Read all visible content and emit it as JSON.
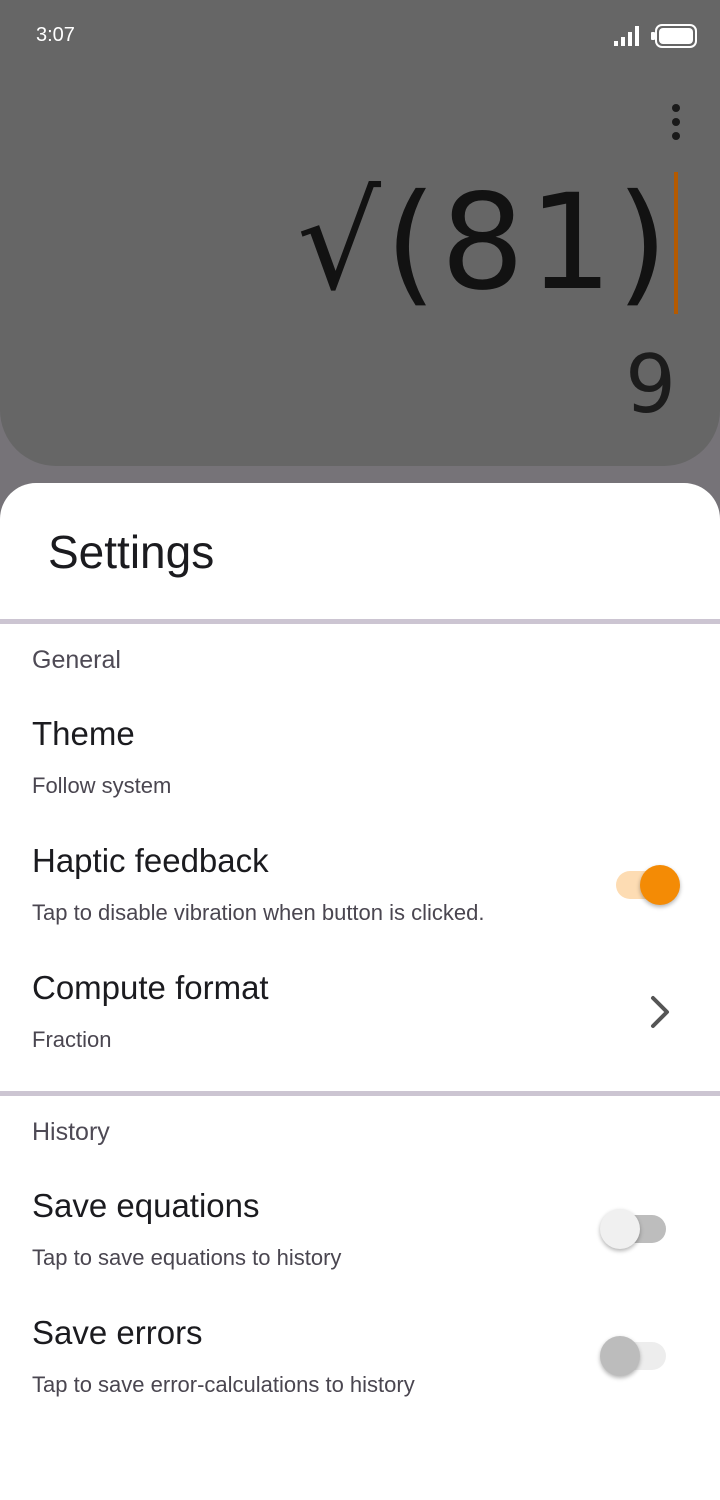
{
  "status_bar": {
    "time": "3:07"
  },
  "calculator": {
    "expression": "√(81)",
    "result": "9"
  },
  "settings": {
    "title": "Settings",
    "sections": {
      "general": {
        "header": "General",
        "theme": {
          "title": "Theme",
          "subtitle": "Follow system"
        },
        "haptic": {
          "title": "Haptic feedback",
          "subtitle": "Tap to disable vibration when button is clicked.",
          "enabled": true
        },
        "compute": {
          "title": "Compute format",
          "subtitle": "Fraction"
        }
      },
      "history": {
        "header": "History",
        "save_equations": {
          "title": "Save equations",
          "subtitle": "Tap to save equations to history",
          "enabled": false
        },
        "save_errors": {
          "title": "Save errors",
          "subtitle": "Tap to save error-calculations to history",
          "enabled": false
        }
      }
    }
  },
  "colors": {
    "accent": "#f48b05",
    "cursor": "#b45a00",
    "divider": "#ccc5d2"
  }
}
